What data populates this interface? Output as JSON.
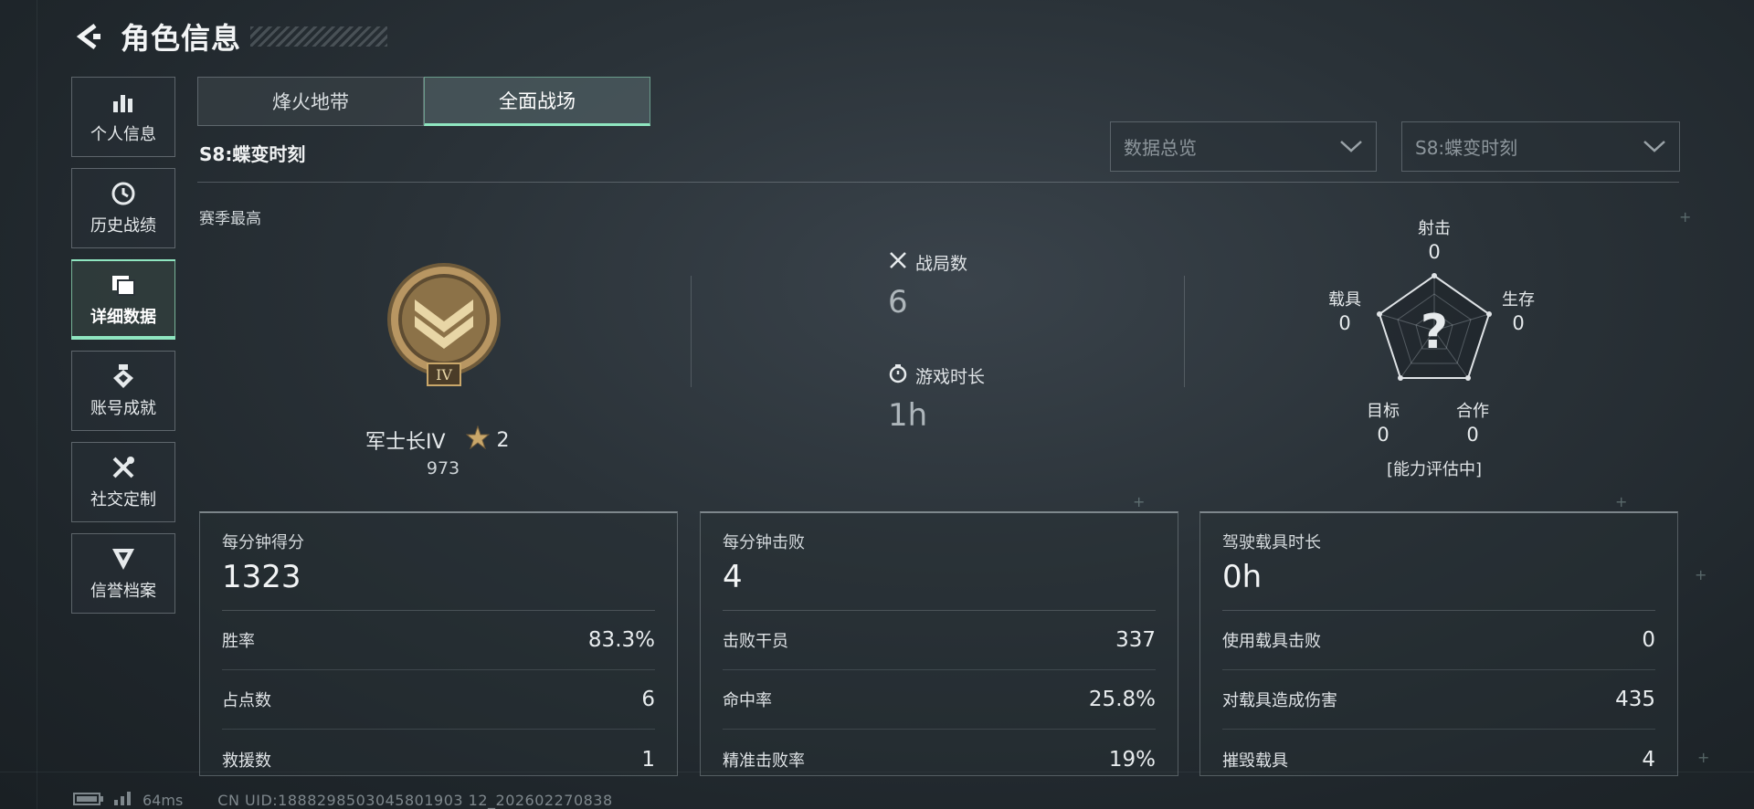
{
  "header": {
    "title": "角色信息"
  },
  "sidebar": {
    "items": [
      {
        "label": "个人信息",
        "icon": "bar-chart-icon"
      },
      {
        "label": "历史战绩",
        "icon": "history-clock-icon"
      },
      {
        "label": "详细数据",
        "icon": "folder-icon",
        "active": true
      },
      {
        "label": "账号成就",
        "icon": "achievement-medal-icon"
      },
      {
        "label": "社交定制",
        "icon": "tools-icon"
      },
      {
        "label": "信誉档案",
        "icon": "shield-rank-icon"
      }
    ]
  },
  "tabs": [
    {
      "label": "烽火地带",
      "active": false
    },
    {
      "label": "全面战场",
      "active": true
    }
  ],
  "season": {
    "title": "S8:蝶变时刻"
  },
  "filters": {
    "data_dropdown": "数据总览",
    "season_dropdown": "S8:蝶变时刻"
  },
  "best": {
    "heading": "赛季最高",
    "rank_name": "军士长IV",
    "stars": "2",
    "score": "973",
    "medal_numeral": "IV"
  },
  "stats": {
    "matches_label": "战局数",
    "matches_value": "6",
    "playtime_label": "游戏时长",
    "playtime_value": "1h"
  },
  "radar": {
    "shooting_label": "射击",
    "shooting_value": "0",
    "survival_label": "生存",
    "survival_value": "0",
    "cooperation_label": "合作",
    "cooperation_value": "0",
    "target_label": "目标",
    "target_value": "0",
    "vehicle_label": "载具",
    "vehicle_value": "0",
    "unknown_mark": "?",
    "status": "[能力评估中]"
  },
  "cards": [
    {
      "title": "每分钟得分",
      "big": "1323",
      "rows": [
        {
          "label": "胜率",
          "value": "83.3%"
        },
        {
          "label": "占点数",
          "value": "6"
        },
        {
          "label": "救援数",
          "value": "1"
        }
      ]
    },
    {
      "title": "每分钟击败",
      "big": "4",
      "rows": [
        {
          "label": "击败干员",
          "value": "337"
        },
        {
          "label": "命中率",
          "value": "25.8%"
        },
        {
          "label": "精准击败率",
          "value": "19%"
        }
      ]
    },
    {
      "title": "驾驶载具时长",
      "big": "0h",
      "rows": [
        {
          "label": "使用载具击败",
          "value": "0"
        },
        {
          "label": "对载具造成伤害",
          "value": "435"
        },
        {
          "label": "摧毁载具",
          "value": "4"
        }
      ]
    }
  ],
  "footer": {
    "ping": "64ms",
    "uid": "CN UID:1888298503045801903 12_202602270838"
  },
  "colors": {
    "accent": "#8fe6c0",
    "medal_gold": "#c9a76a"
  }
}
